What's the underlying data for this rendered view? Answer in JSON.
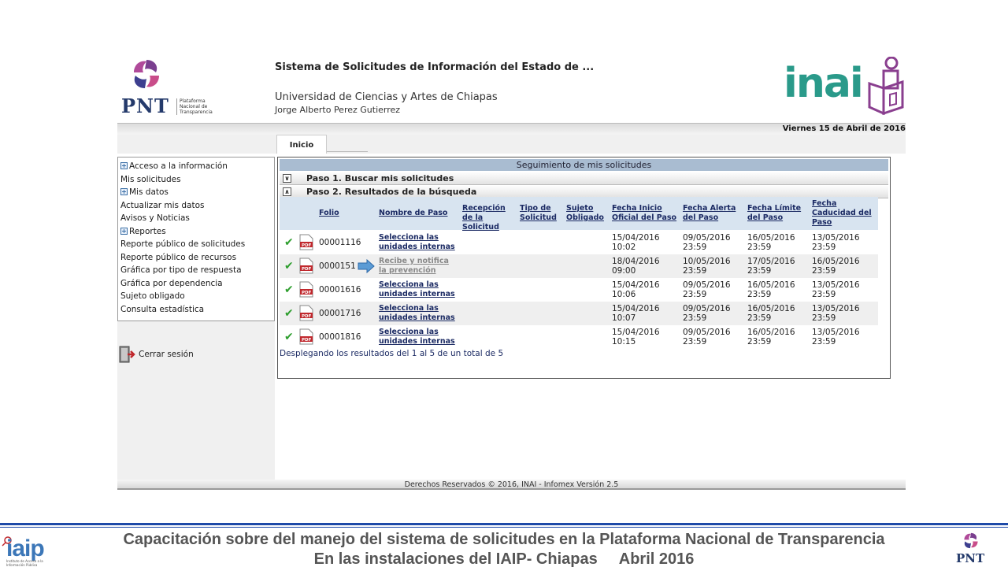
{
  "header": {
    "pnt_logo_text": "PNT",
    "pnt_logo_sub": "Plataforma Nacional de Transparencia",
    "system_title": "Sistema de Solicitudes de Información del Estado de ...",
    "institution": "Universidad de Ciencias y Artes de Chiapas",
    "user_name": "Jorge Alberto Perez Gutierrez",
    "inai_logo_text": "inai",
    "date": "Viernes 15 de Abril de 2016"
  },
  "tabs": [
    {
      "label": "Inicio"
    }
  ],
  "sidebar": {
    "items": [
      {
        "label": "Acceso a la información",
        "expandable": true
      },
      {
        "label": "Mis solicitudes",
        "expandable": false
      },
      {
        "label": "Mis datos",
        "expandable": true
      },
      {
        "label": "Actualizar mis datos",
        "expandable": false
      },
      {
        "label": "Avisos y Noticias",
        "expandable": false
      },
      {
        "label": "Reportes",
        "expandable": true
      },
      {
        "label": "Reporte público de solicitudes",
        "expandable": false
      },
      {
        "label": "Reporte público de recursos",
        "expandable": false
      },
      {
        "label": "Gráfica por tipo de respuesta",
        "expandable": false
      },
      {
        "label": "Gráfica por dependencia",
        "expandable": false
      },
      {
        "label": "Sujeto obligado",
        "expandable": false
      },
      {
        "label": "Consulta estadística",
        "expandable": false
      }
    ],
    "logout_label": "Cerrar sesión"
  },
  "main": {
    "panel_title": "Seguimiento de mis solicitudes",
    "step1": "Paso 1. Buscar mis solicitudes",
    "step2": "Paso 2. Resultados de la búsqueda",
    "columns": {
      "folio": "Folio",
      "nombre_paso": "Nombre de Paso",
      "recepcion": "Recepción de la Solicitud",
      "tipo": "Tipo de Solicitud",
      "sujeto": "Sujeto Obligado",
      "fecha_inicio": "Fecha Inicio Oficial del Paso",
      "fecha_alerta": "Fecha Alerta del Paso",
      "fecha_limite": "Fecha Límite del Paso",
      "fecha_caducidad": "Fecha Caducidad del Paso"
    },
    "rows": [
      {
        "folio": "00001116",
        "paso": "Selecciona las unidades internas",
        "inicio": "15/04/2016",
        "inicio_h": "10:02",
        "alerta": "09/05/2016",
        "alerta_h": "23:59",
        "limite": "16/05/2016",
        "limite_h": "23:59",
        "caducidad": "13/05/2016",
        "caducidad_h": "23:59"
      },
      {
        "folio": "0000151",
        "paso": "Recibe y notifica la prevención",
        "inicio": "18/04/2016",
        "inicio_h": "09:00",
        "alerta": "10/05/2016",
        "alerta_h": "23:59",
        "limite": "17/05/2016",
        "limite_h": "23:59",
        "caducidad": "16/05/2016",
        "caducidad_h": "23:59"
      },
      {
        "folio": "00001616",
        "paso": "Selecciona las unidades internas",
        "inicio": "15/04/2016",
        "inicio_h": "10:06",
        "alerta": "09/05/2016",
        "alerta_h": "23:59",
        "limite": "16/05/2016",
        "limite_h": "23:59",
        "caducidad": "13/05/2016",
        "caducidad_h": "23:59"
      },
      {
        "folio": "00001716",
        "paso": "Selecciona las unidades internas",
        "inicio": "15/04/2016",
        "inicio_h": "10:07",
        "alerta": "09/05/2016",
        "alerta_h": "23:59",
        "limite": "16/05/2016",
        "limite_h": "23:59",
        "caducidad": "13/05/2016",
        "caducidad_h": "23:59"
      },
      {
        "folio": "00001816",
        "paso": "Selecciona las unidades internas",
        "inicio": "15/04/2016",
        "inicio_h": "10:15",
        "alerta": "09/05/2016",
        "alerta_h": "23:59",
        "limite": "16/05/2016",
        "limite_h": "23:59",
        "caducidad": "13/05/2016",
        "caducidad_h": "23:59"
      }
    ],
    "summary": "Desplegando los resultados del 1 al 5 de un total de 5"
  },
  "footer": "Derechos Reservados © 2016, INAI - Infomex Versión 2.5",
  "slide": {
    "caption_line1": "Capacitación sobre del manejo del sistema de solicitudes en la Plataforma Nacional de Transparencia",
    "caption_line2": "En las instalaciones del IAIP- Chiapas     Abril 2016",
    "iaip_text": "iaip",
    "iaip_sub": "Instituto de Acceso a la Información Pública",
    "pnt_small_text": "PNT"
  },
  "colors": {
    "accent_blue": "#1b2a63",
    "panel_header": "#a9bcd1",
    "table_header": "#d8e4f0",
    "check_green": "#2e9e2e",
    "inai_teal": "#2a9a8a"
  },
  "icons": [
    "pnt-logo",
    "inai-logo",
    "expand-icon",
    "chevron-icon",
    "check-icon",
    "pdf-icon",
    "arrow-pointer-icon",
    "logout-icon",
    "iaip-logo"
  ]
}
